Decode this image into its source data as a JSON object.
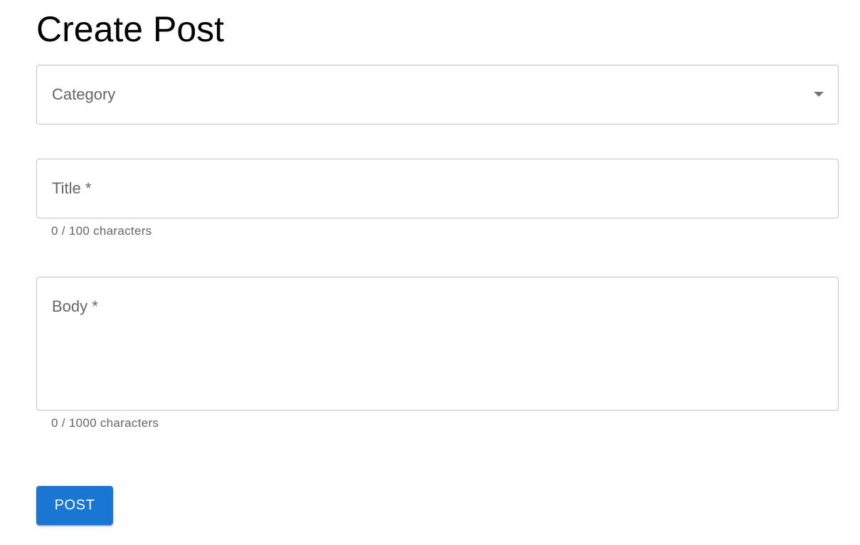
{
  "page": {
    "title": "Create Post"
  },
  "form": {
    "category": {
      "label": "Category",
      "selected_value": ""
    },
    "title": {
      "label": "Title *",
      "value": "",
      "helper": "0 / 100 characters"
    },
    "body": {
      "label": "Body *",
      "value": "",
      "helper": "0 / 1000 characters"
    },
    "submit_label": "POST"
  },
  "colors": {
    "primary": "#1976d2",
    "border": "#c4c4c4",
    "label": "#666666"
  }
}
